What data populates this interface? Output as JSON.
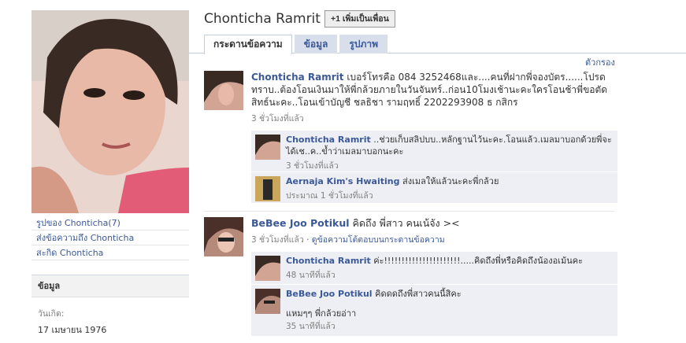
{
  "profile": {
    "name": "Chonticha Ramrit",
    "add_friend": "+1 เพิ่มเป็นเพื่อน"
  },
  "tabs": [
    {
      "label": "กระดานข้อความ",
      "active": true
    },
    {
      "label": "ข้อมูล",
      "active": false
    },
    {
      "label": "รูปภาพ",
      "active": false
    }
  ],
  "filter_label": "ตัวกรอง",
  "sidebar": {
    "links": [
      "รูปของ Chonticha(7)",
      "ส่งข้อความถึง Chonticha",
      "สะกิด Chonticha"
    ],
    "info_heading": "ข้อมูล",
    "birthday_label": "วันเกิด:",
    "birthday_value": "17 เมษายน 1976"
  },
  "stories": [
    {
      "author": "Chonticha Ramrit",
      "text": " เบอร์โทรคือ 084 3252468และ....คนที่ฝากพี่จองบัตร......โปรดทราบ..ต้องโอนเงินมาให้พี่กล้วยภายในวันจันทร์..ก่อน10โมงเช้านะคะใครโอนช้าพี่ขอตัดสิทธ์นะคะ..โอนเข้าบัญชี ชลธิชา รามฤทธิ์ 2202293908 ธ กสิกร",
      "time": "3 ชั่วโมงที่แล้ว",
      "comments": [
        {
          "author": "Chonticha Ramrit",
          "text": " ..ช่วยเก็บสลิปบบ..หลักฐานไว้นะคะ.โอนแล้ว.เมลมาบอกด้วยพี่จะได้เช..ค..ข้ำว่าเมลมาบอกนะคะ",
          "time": "3 ชั่วโมงที่แล้ว"
        },
        {
          "author": "Aernaja Kim's Hwaiting",
          "text": " ส่งเมลให้แล้วนะคะพี่กล้วย",
          "time": "ประมาณ 1 ชั่วโมงที่แล้ว"
        }
      ]
    },
    {
      "author": "BeBee Joo Potikul",
      "text": " คิดถึง พี่สาว คนเน้จัง ><",
      "time": "3 ชั่วโมงที่แล้ว",
      "extra": " · ดูข้อความโต้ตอบบนกระดานข้อความ",
      "comments": [
        {
          "author": "Chonticha Ramrit",
          "text": " ค่ะ!!!!!!!!!!!!!!!!!!!!!!.....คิดถึงพี่หรือคิดถึงน้องอเม้นคะ",
          "time": "48 นาทีที่แล้ว"
        },
        {
          "author": "BeBee Joo Potikul",
          "text": " คิดดดถึงพี่สาวคนนี้สิคะ",
          "text2": "แหมๆๆ พี่กล้วยอ่าา",
          "time": "35 นาทีที่แล้ว"
        }
      ]
    }
  ]
}
